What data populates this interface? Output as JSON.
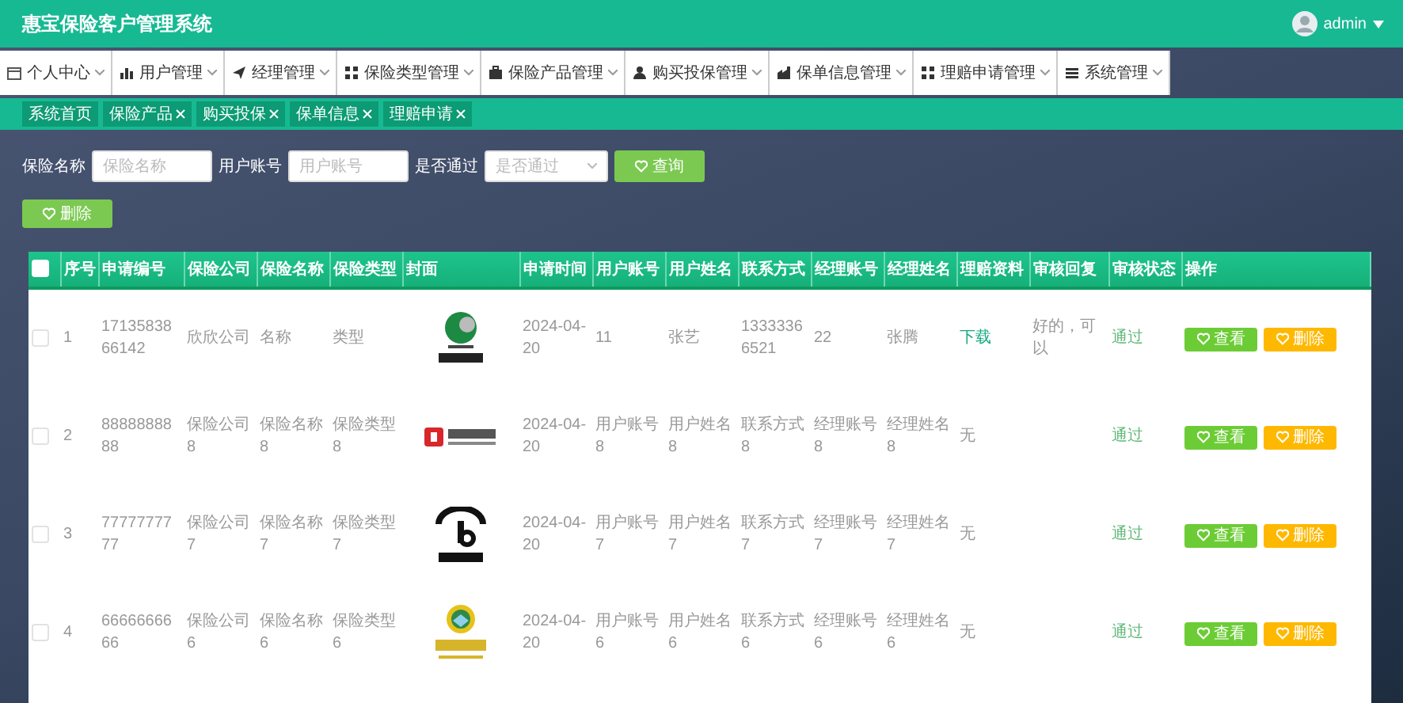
{
  "header": {
    "title": "惠宝保险客户管理系统",
    "user": "admin"
  },
  "menu": [
    {
      "label": "个人中心"
    },
    {
      "label": "用户管理"
    },
    {
      "label": "经理管理"
    },
    {
      "label": "保险类型管理"
    },
    {
      "label": "保险产品管理"
    },
    {
      "label": "购买投保管理"
    },
    {
      "label": "保单信息管理"
    },
    {
      "label": "理赔申请管理"
    },
    {
      "label": "系统管理"
    }
  ],
  "tags": [
    {
      "label": "系统首页",
      "closable": false
    },
    {
      "label": "保险产品",
      "closable": true
    },
    {
      "label": "购买投保",
      "closable": true
    },
    {
      "label": "保单信息",
      "closable": true
    },
    {
      "label": "理赔申请",
      "closable": true
    }
  ],
  "search": {
    "fields": [
      {
        "label": "保险名称",
        "placeholder": "保险名称",
        "kind": "input"
      },
      {
        "label": "用户账号",
        "placeholder": "用户账号",
        "kind": "input"
      },
      {
        "label": "是否通过",
        "placeholder": "是否通过",
        "kind": "select"
      }
    ],
    "search_button": "查询",
    "delete_button": "删除"
  },
  "table": {
    "select_all": {
      "checked": false
    },
    "columns": [
      "序号",
      "申请编号",
      "保险公司",
      "保险名称",
      "保险类型",
      "封面",
      "申请时间",
      "用户账号",
      "用户姓名",
      "联系方式",
      "经理账号",
      "经理姓名",
      "理赔资料",
      "审核回复",
      "审核状态",
      "操作"
    ],
    "rows": [
      {
        "checked": false,
        "cells": [
          "1",
          "1713583866142",
          "欣欣公司",
          "名称",
          "类型",
          {
            "kind": "picture"
          },
          "2024-04-20",
          "11",
          "张艺",
          "13333366521",
          "22",
          "张腾",
          {
            "text": "下载",
            "kind": "link"
          },
          "好的，可以",
          "通过"
        ],
        "actions": [
          "查看",
          "删除"
        ]
      },
      {
        "checked": false,
        "cells": [
          "2",
          "8888888888",
          "保险公司8",
          "保险名称8",
          "保险类型8",
          {
            "kind": "picture"
          },
          "2024-04-20",
          "用户账号8",
          "用户姓名8",
          "联系方式8",
          "经理账号8",
          "经理姓名8",
          {
            "text": "无",
            "kind": "text"
          },
          "",
          "通过"
        ],
        "actions": [
          "查看",
          "删除"
        ]
      },
      {
        "checked": false,
        "cells": [
          "3",
          "7777777777",
          "保险公司7",
          "保险名称7",
          "保险类型7",
          {
            "kind": "picture"
          },
          "2024-04-20",
          "用户账号7",
          "用户姓名7",
          "联系方式7",
          "经理账号7",
          "经理姓名7",
          {
            "text": "无",
            "kind": "text"
          },
          "",
          "通过"
        ],
        "actions": [
          "查看",
          "删除"
        ]
      },
      {
        "checked": false,
        "cells": [
          "4",
          "6666666666",
          "保险公司6",
          "保险名称6",
          "保险类型6",
          {
            "kind": "picture"
          },
          "2024-04-20",
          "用户账号6",
          "用户姓名6",
          "联系方式6",
          "经理账号6",
          "经理姓名6",
          {
            "text": "无",
            "kind": "text"
          },
          "",
          "通过"
        ],
        "actions": [
          "查看",
          "删除"
        ]
      }
    ]
  }
}
